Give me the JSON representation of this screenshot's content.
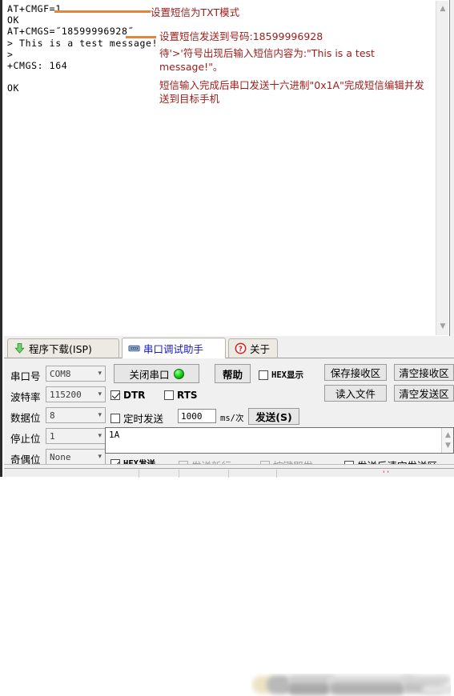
{
  "terminal": {
    "lines": [
      "AT+CMGF=1",
      "OK",
      "AT+CMGS=˝18599996928˝",
      "> This is a test message!",
      ">",
      "+CMGS: 164",
      "",
      "OK"
    ],
    "text": "AT+CMGF=1\nOK\nAT+CMGS=˝18599996928˝\n> This is a test message!\n>\n+CMGS: 164\n\nOK"
  },
  "annotations": [
    {
      "id": "a1",
      "text": "设置短信为TXT模式"
    },
    {
      "id": "a2",
      "text": "设置短信发送到号码:18599996928"
    },
    {
      "id": "a3",
      "text": "待'>'符号出现后输入短信内容为:\"This is a test message!\"。"
    },
    {
      "id": "a4",
      "text": "短信输入完成后串口发送十六进制\"0x1A\"完成短信编辑并发送到目标手机"
    }
  ],
  "colors": {
    "annotation_text": "#9c1b17",
    "annotation_line": "#e8833a",
    "active_tab_text": "#1717cf",
    "led_on": "#20c020"
  },
  "tabs": [
    {
      "label": "程序下载(ISP)",
      "icon": "download-arrow-icon",
      "active": false
    },
    {
      "label": "串口调试助手",
      "icon": "serial-port-icon",
      "active": true
    },
    {
      "label": "关于",
      "icon": "question-mark-icon",
      "active": false
    }
  ],
  "controls": {
    "port_label": "串口号",
    "port_value": "COM8",
    "baud_label": "波特率",
    "baud_value": "115200",
    "databits_label": "数据位",
    "databits_value": "8",
    "stopbits_label": "停止位",
    "stopbits_value": "1",
    "parity_label": "奇偶位",
    "parity_value": "None",
    "close_port_button": "关闭串口",
    "help_button": "帮助",
    "hex_display_label": "HEX显示",
    "hex_display_checked": false,
    "dtr_label": "DTR",
    "dtr_checked": true,
    "rts_label": "RTS",
    "rts_checked": false,
    "timed_send_label": "定时发送",
    "timed_send_checked": false,
    "timed_interval_value": "1000",
    "timed_unit_label": "ms/次",
    "send_button": "发送(S)",
    "save_recv_button": "保存接收区",
    "clear_recv_button": "清空接收区",
    "load_file_button": "读入文件",
    "clear_send_button": "清空发送区",
    "send_text_value": "1A",
    "hex_send_label": "HEX发送",
    "hex_send_checked": true,
    "send_newline_label": "发送新行",
    "send_newline_checked": true,
    "send_newline_disabled": true,
    "key_send_label": "按键即发",
    "key_send_checked": false,
    "key_send_disabled": true,
    "clear_after_send_label": "发送后清空发送区",
    "clear_after_send_checked": false
  },
  "statusbar": {
    "marks": "''"
  }
}
